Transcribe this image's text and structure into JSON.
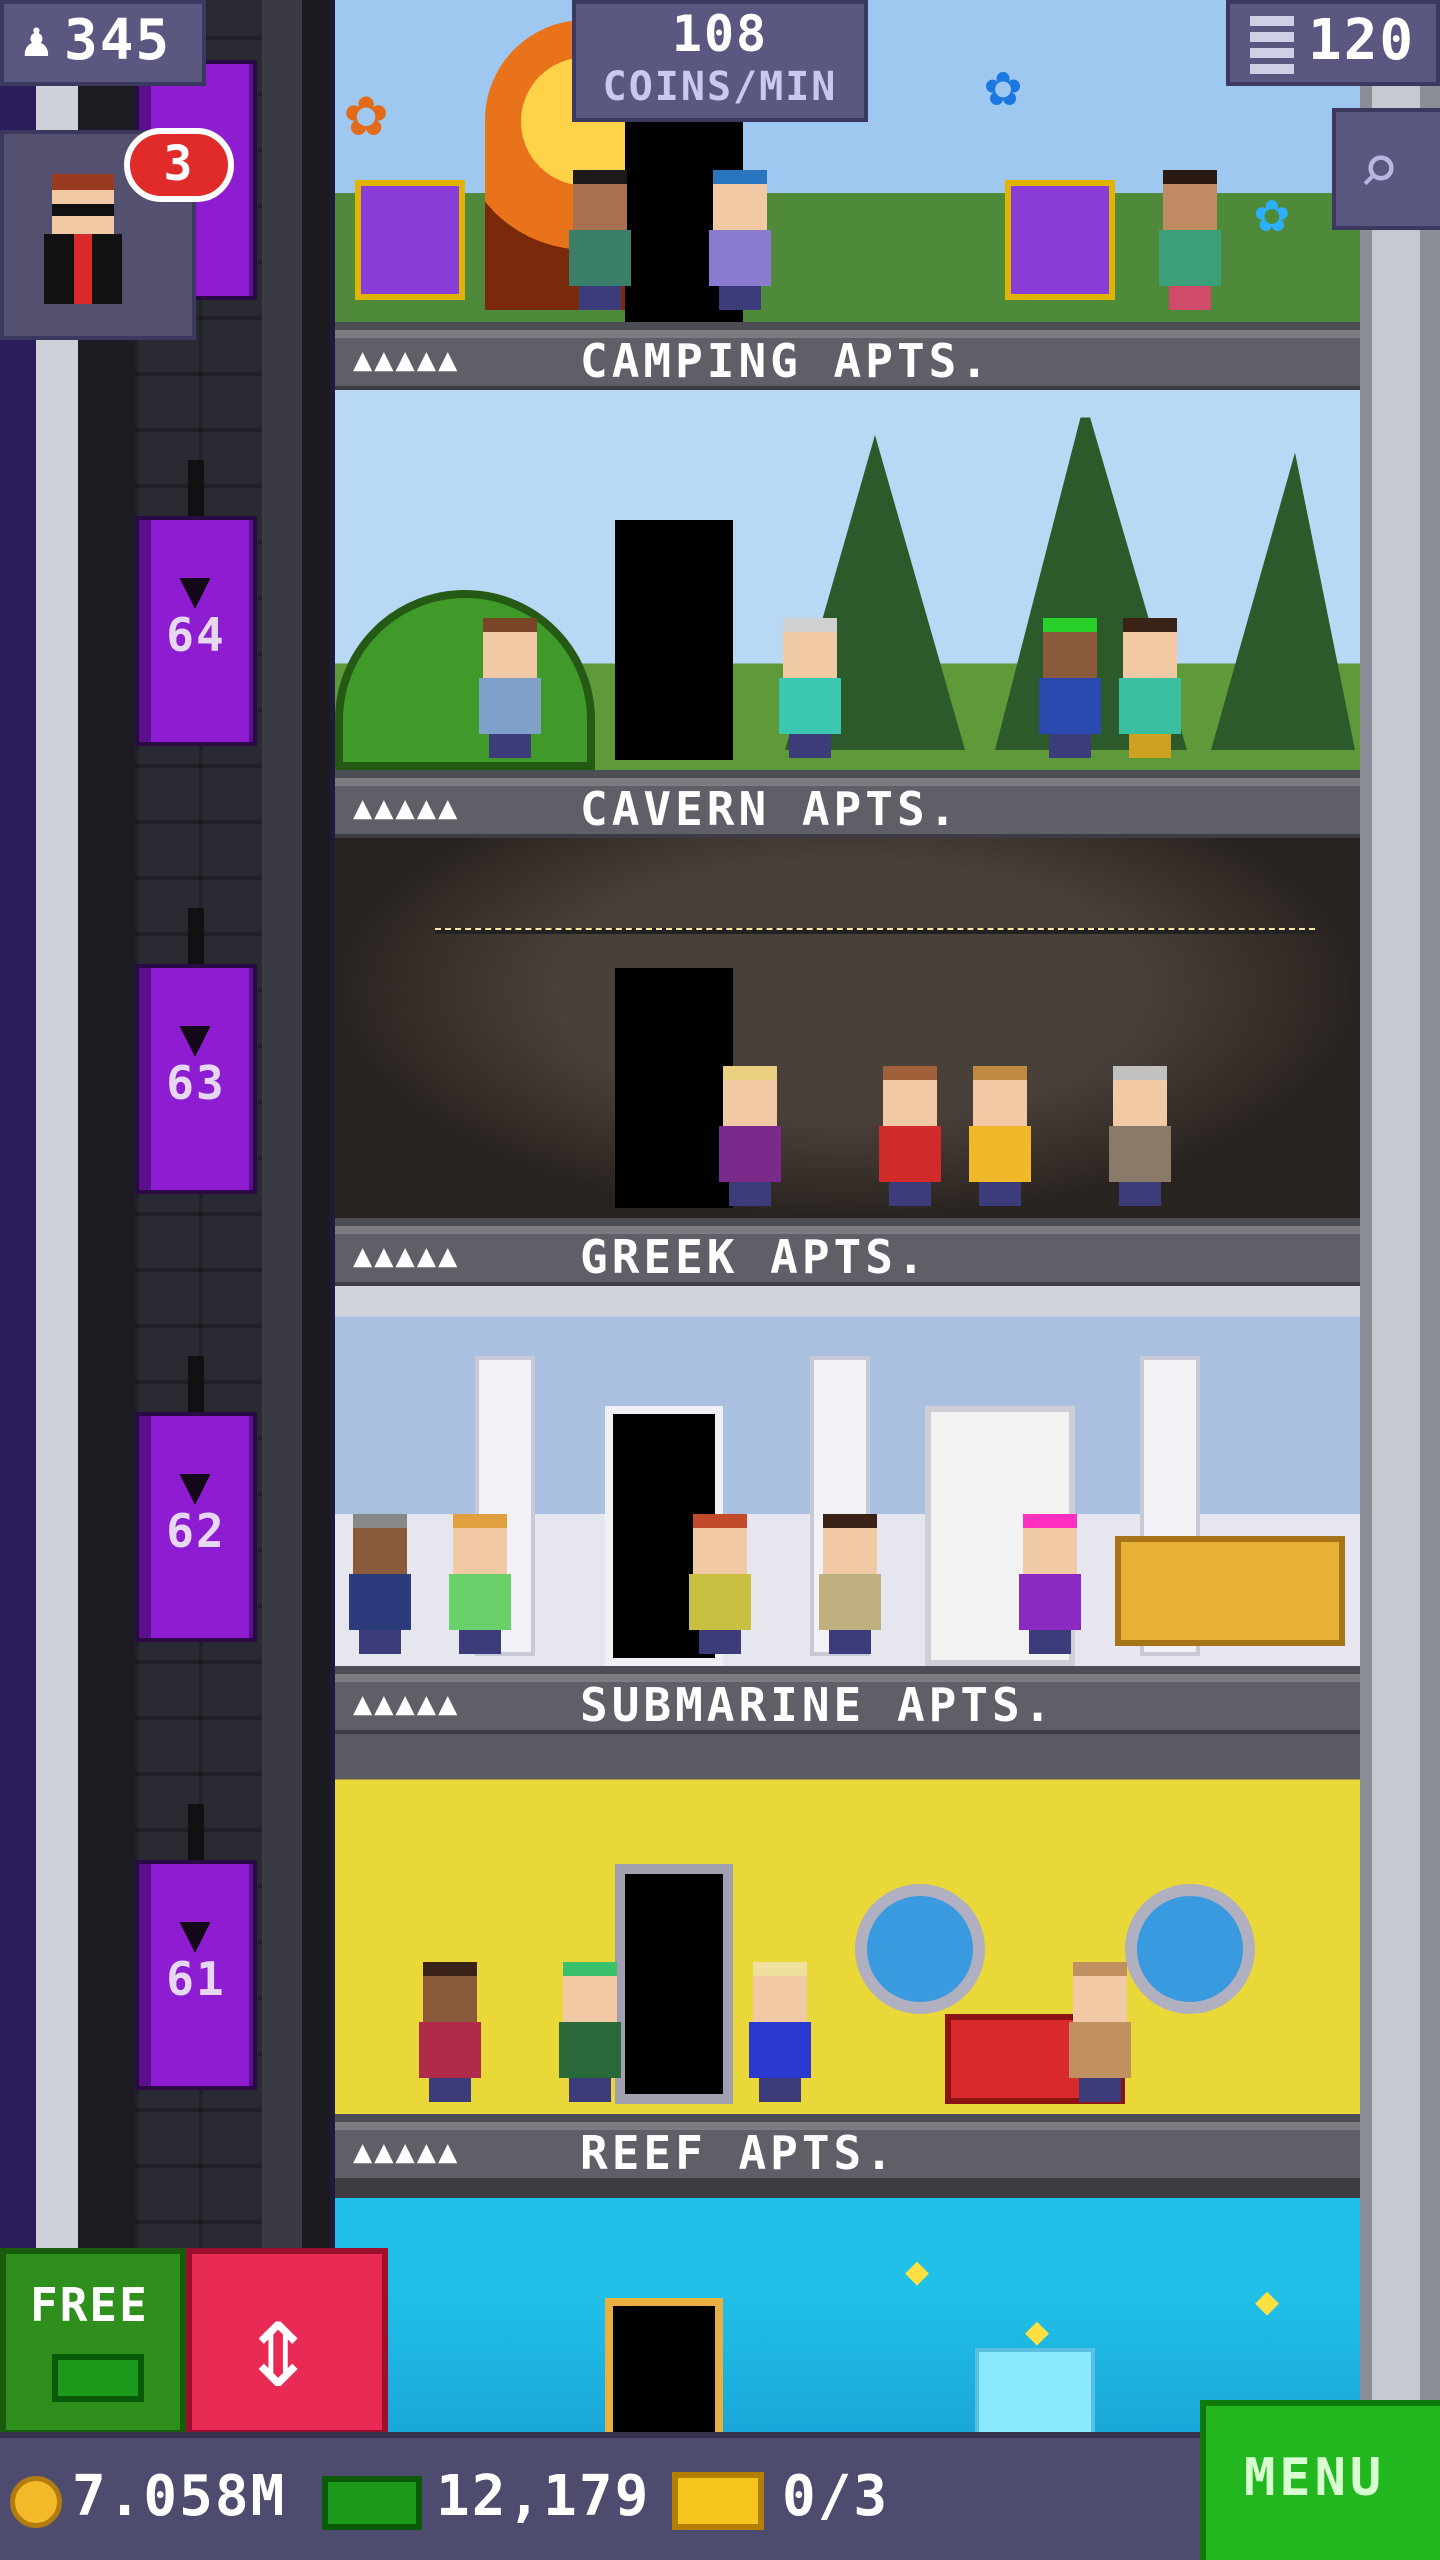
{
  "hud": {
    "population": "345",
    "coins_per_min_value": "108",
    "coins_per_min_label": "COINS/MIN",
    "floors": "120",
    "vip_count": "3"
  },
  "floors": [
    {
      "name": "CAMPING APTS.",
      "people": "▲▲▲▲▲",
      "elevator_number": "64"
    },
    {
      "name": "CAVERN APTS.",
      "people": "▲▲▲▲▲",
      "elevator_number": "63"
    },
    {
      "name": "GREEK APTS.",
      "people": "▲▲▲▲▲",
      "elevator_number": "62"
    },
    {
      "name": "SUBMARINE APTS.",
      "people": "▲▲▲▲▲",
      "elevator_number": "61"
    },
    {
      "name": "REEF APTS.",
      "people": "▲▲▲▲▲",
      "elevator_number": ""
    }
  ],
  "bottom": {
    "coins": "7.058M",
    "bux": "12,179",
    "tickets": "0/3",
    "menu_label": "MENU",
    "free_label": "FREE"
  },
  "colors": {
    "elevator": "#8e1cd0",
    "menu": "#22b71f",
    "elevator_button": "#e82a55",
    "coin": "#f3b928"
  },
  "icons": {
    "population": "person-icon",
    "floors": "building-icon",
    "search": "magnifier-icon",
    "elevator": "up-down-arrows-icon",
    "coin": "coin-icon",
    "bux": "bux-icon",
    "ticket": "ticket-icon"
  }
}
